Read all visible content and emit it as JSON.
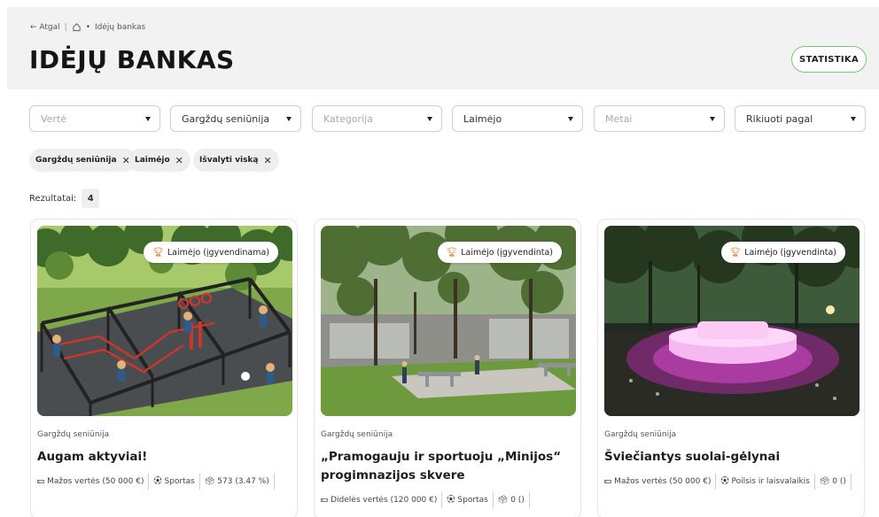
{
  "breadcrumb": {
    "back": "← Atgal",
    "current": "Idėjų bankas"
  },
  "page": {
    "title": "IDĖJŲ BANKAS",
    "stat_button": "STATISTIKA"
  },
  "filters": [
    {
      "label": "Vertė",
      "placeholder": true
    },
    {
      "label": "Gargždų seniūnija",
      "placeholder": false
    },
    {
      "label": "Kategorija",
      "placeholder": true
    },
    {
      "label": "Laimėjo",
      "placeholder": false
    },
    {
      "label": "Metai",
      "placeholder": true
    },
    {
      "label": "Rikiuoti pagal",
      "placeholder": false
    }
  ],
  "chips": [
    {
      "label": "Gargždų seniūnija"
    },
    {
      "label": "Laimėjo"
    },
    {
      "label": "Išvalyti viską"
    }
  ],
  "results": {
    "label": "Rezultatai:",
    "count": "4"
  },
  "cards": [
    {
      "badge": "Laimėjo (įgyvendinama)",
      "area": "Gargždų seniūnija",
      "title": "Augam aktyviai!",
      "value": "Mažos vertės (50 000 €)",
      "category": "Sportas",
      "votes": "573 (3.47 %)"
    },
    {
      "badge": "Laimėjo (įgyvendinta)",
      "area": "Gargždų seniūnija",
      "title": "„Pramogauju ir sportuoju „Minijos“ progimnazijos skvere",
      "value": "Didelės vertės (120 000 €)",
      "category": "Sportas",
      "votes": "0 ()"
    },
    {
      "badge": "Laimėjo (įgyvendinta)",
      "area": "Gargždų seniūnija",
      "title": "Šviečiantys suolai-gėlynai",
      "value": "Mažos vertės (50 000 €)",
      "category": "Poilsis ir laisvalaikis",
      "votes": "0 ()"
    }
  ],
  "colors": {
    "accent_green": "#7cc47a",
    "trophy": "#d97b2a",
    "header_bg": "#f2f2f2"
  }
}
